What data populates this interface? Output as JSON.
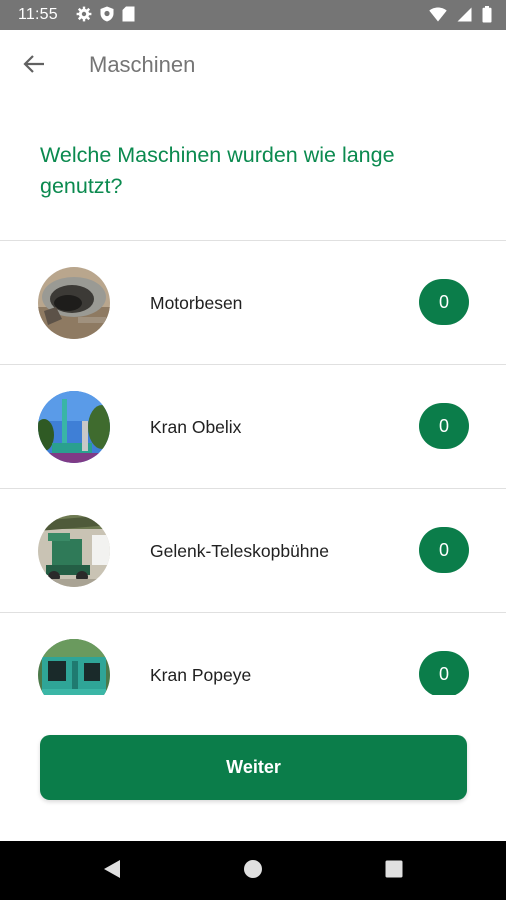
{
  "status_bar": {
    "time": "11:55",
    "left_icons": [
      "gear-icon",
      "shield-icon",
      "sd-card-icon"
    ],
    "right_icons": [
      "wifi-icon",
      "signal-icon",
      "battery-icon"
    ]
  },
  "app_bar": {
    "back_icon": "arrow-back-icon",
    "title": "Maschinen"
  },
  "question": "Welche Maschinen wurden wie lange genutzt?",
  "machines": [
    {
      "name": "Motorbesen",
      "count": "0"
    },
    {
      "name": "Kran Obelix",
      "count": "0"
    },
    {
      "name": "Gelenk-Teleskopbühne",
      "count": "0"
    },
    {
      "name": "Kran Popeye",
      "count": "0"
    }
  ],
  "continue_label": "Weiter",
  "nav_bar": {
    "buttons": [
      "back-triangle-icon",
      "home-circle-icon",
      "recents-square-icon"
    ]
  },
  "colors": {
    "accent": "#0b7d4a",
    "question_text": "#0b8a4f",
    "status_bar": "#757575"
  }
}
